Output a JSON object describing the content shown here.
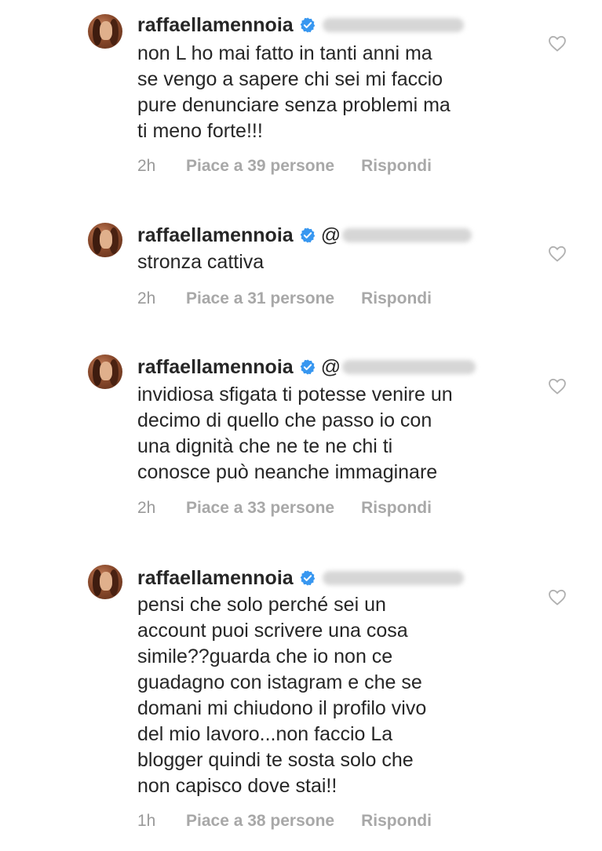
{
  "comments": [
    {
      "username": "raffaellamennoia",
      "mention_prefix": "",
      "lines": "non L ho mai fatto in tanti anni ma\nse vengo a sapere chi sei mi faccio\npure denunciare senza problemi ma\nti meno forte!!!",
      "time": "2h",
      "likes": "Piace a 39 persone",
      "reply": "Rispondi"
    },
    {
      "username": "raffaellamennoia",
      "mention_prefix": "@",
      "lines": "stronza cattiva",
      "time": "2h",
      "likes": "Piace a 31 persone",
      "reply": "Rispondi"
    },
    {
      "username": "raffaellamennoia",
      "mention_prefix": "@",
      "lines": "invidiosa sfigata ti potesse venire un\ndecimo di quello che passo io con\nuna dignità che ne te ne chi ti\nconosce può neanche immaginare",
      "time": "2h",
      "likes": "Piace a 33 persone",
      "reply": "Rispondi"
    },
    {
      "username": "raffaellamennoia",
      "mention_prefix": "",
      "lines": "pensi che solo perché sei un\naccount puoi scrivere una cosa\nsimile??guarda che io non ce\nguadagno con istagram e che se\ndomani mi chiudono il profilo vivo\ndel mio lavoro...non faccio La\nblogger quindi te sosta solo che\nnon capisco dove stai!!",
      "time": "1h",
      "likes": "Piace a 38 persone",
      "reply": "Rispondi"
    }
  ],
  "icons": {
    "verified": "verified-badge-icon",
    "like": "heart-outline-icon"
  },
  "colors": {
    "text": "#262626",
    "meta": "#a8a8a8",
    "verified": "#3897f0"
  }
}
